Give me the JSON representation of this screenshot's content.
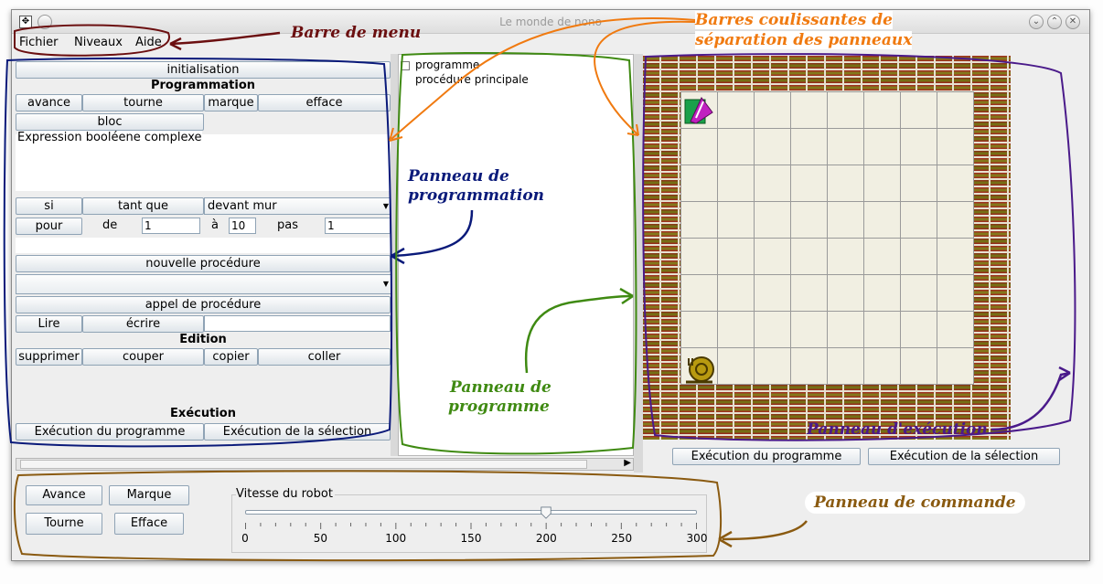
{
  "window": {
    "title": "Le monde de nono"
  },
  "menu": {
    "items": [
      "Fichier",
      "Niveaux",
      "Aide"
    ]
  },
  "programming_panel": {
    "init_button": "initialisation",
    "programmation_header": "Programmation",
    "buttons_row1": [
      "avance",
      "tourne",
      "marque",
      "efface"
    ],
    "bloc_button": "bloc",
    "bool_expr_label": "Expression booléene complexe",
    "si_button": "si",
    "tant_que_button": "tant que",
    "condition_combo": "devant mur",
    "pour_button": "pour",
    "de_label": "de",
    "de_value": "1",
    "a_label": "à",
    "a_value": "10",
    "pas_label": "pas",
    "pas_value": "1",
    "nouvelle_procedure_button": "nouvelle procédure",
    "appel_procedure_button": "appel de procédure",
    "lire_button": "Lire",
    "ecrire_button": "écrire",
    "edition_header": "Edition",
    "edit_buttons": [
      "supprimer",
      "couper",
      "copier",
      "coller"
    ],
    "execution_header": "Exécution",
    "exec_program_button": "Exécution du programme",
    "exec_selection_button": "Exécution de la sélection"
  },
  "program_panel": {
    "tree": [
      "programme",
      "procédure principale"
    ]
  },
  "execution_panel": {
    "exec_program_button": "Exécution du programme",
    "exec_selection_button": "Exécution de la sélection"
  },
  "command_panel": {
    "avance_button": "Avance",
    "marque_button": "Marque",
    "tourne_button": "Tourne",
    "efface_button": "Efface",
    "speed_label": "Vitesse du robot",
    "speed_value": 200,
    "speed_min": 0,
    "speed_max": 300,
    "speed_ticks": [
      "0",
      "50",
      "100",
      "150",
      "200",
      "250",
      "300"
    ]
  },
  "annotations": {
    "menu_bar": "Barre de menu",
    "sliders_line1": "Barres coulissantes de",
    "sliders_line2": "séparation des panneaux",
    "programming_line1": "Panneau de",
    "programming_line2": "programmation",
    "program_line1": "Panneau de",
    "program_line2": "programme",
    "execution": "Panneau d'exécution",
    "command": "Panneau de commande"
  },
  "colors": {
    "menu_annotation": "#6b0f10",
    "slider_annotation": "#f07a10",
    "programming_annotation": "#0a1a7a",
    "program_annotation": "#3f8a12",
    "execution_annotation": "#4a1a8a",
    "command_annotation": "#8a5a10"
  }
}
